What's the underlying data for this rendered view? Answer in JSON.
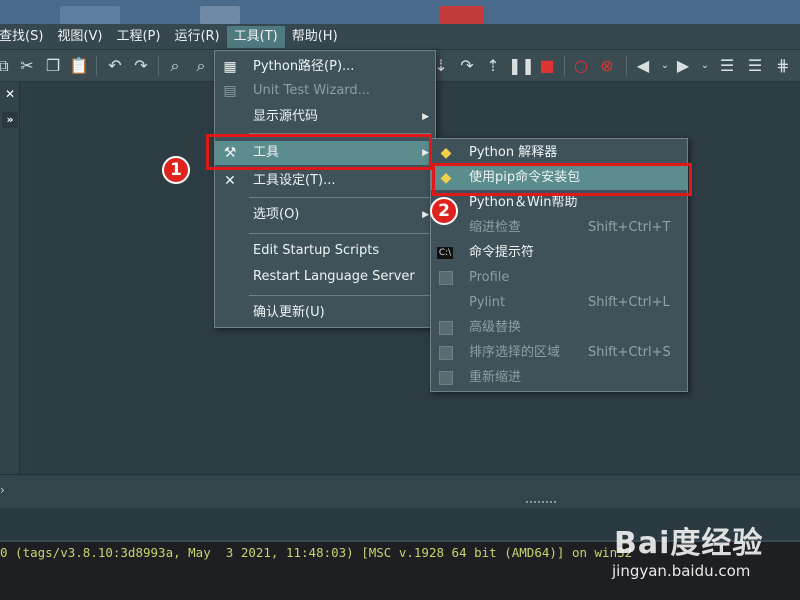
{
  "menubar": {
    "items": [
      "查找(S)",
      "视图(V)",
      "工程(P)",
      "运行(R)",
      "工具(T)",
      "帮助(H)"
    ],
    "active_index": 4
  },
  "tools_menu": {
    "items": [
      {
        "label": "Python路径(P)...",
        "icon": "python-path-icon",
        "disabled": false
      },
      {
        "label": "Unit Test Wizard...",
        "icon": "clipboard-icon",
        "disabled": true
      },
      {
        "label": "显示源代码",
        "icon": "",
        "disabled": false,
        "submenu": true
      },
      {
        "label": "工具",
        "icon": "hammer-icon",
        "disabled": false,
        "submenu": true,
        "highlighted": true
      },
      {
        "label": "工具设定(T)...",
        "icon": "tools-settings-icon",
        "disabled": false
      },
      {
        "label": "选项(O)",
        "icon": "",
        "disabled": false,
        "submenu": true
      },
      {
        "label": "Edit Startup Scripts",
        "icon": "",
        "disabled": false
      },
      {
        "label": "Restart Language Server",
        "icon": "",
        "disabled": false
      },
      {
        "label": "确认更新(U)",
        "icon": "",
        "disabled": false
      }
    ]
  },
  "tools_submenu": {
    "items": [
      {
        "label": "Python 解释器",
        "shortcut": "",
        "icon": "python-icon",
        "disabled": false
      },
      {
        "label": "使用pip命令安装包",
        "shortcut": "",
        "icon": "python-icon",
        "disabled": false,
        "highlighted": true
      },
      {
        "label": "Python＆Win帮助",
        "shortcut": "",
        "icon": "",
        "disabled": false
      },
      {
        "label": "缩进检查",
        "shortcut": "Shift+Ctrl+T",
        "icon": "",
        "disabled": true
      },
      {
        "label": "命令提示符",
        "shortcut": "",
        "icon": "cmd-icon",
        "disabled": false
      },
      {
        "label": "Profile",
        "shortcut": "",
        "icon": "",
        "disabled": true
      },
      {
        "label": "Pylint",
        "shortcut": "Shift+Ctrl+L",
        "icon": "",
        "disabled": true
      },
      {
        "label": "高级替换",
        "shortcut": "",
        "icon": "",
        "disabled": true
      },
      {
        "label": "排序选择的区域",
        "shortcut": "Shift+Ctrl+S",
        "icon": "",
        "disabled": true
      },
      {
        "label": "重新缩进",
        "shortcut": "",
        "icon": "",
        "disabled": true
      }
    ]
  },
  "badges": {
    "one": "1",
    "two": "2"
  },
  "console": {
    "text": "0 (tags/v3.8.10:3d8993a, May  3 2021, 11:48:03) [MSC v.1928 64 bit (AMD64)] on win32"
  },
  "watermark": {
    "brand": "Bai度经验",
    "url": "jingyan.baidu.com"
  },
  "colors": {
    "highlight": "#5b8c8e",
    "annotation_red": "#e01818"
  }
}
